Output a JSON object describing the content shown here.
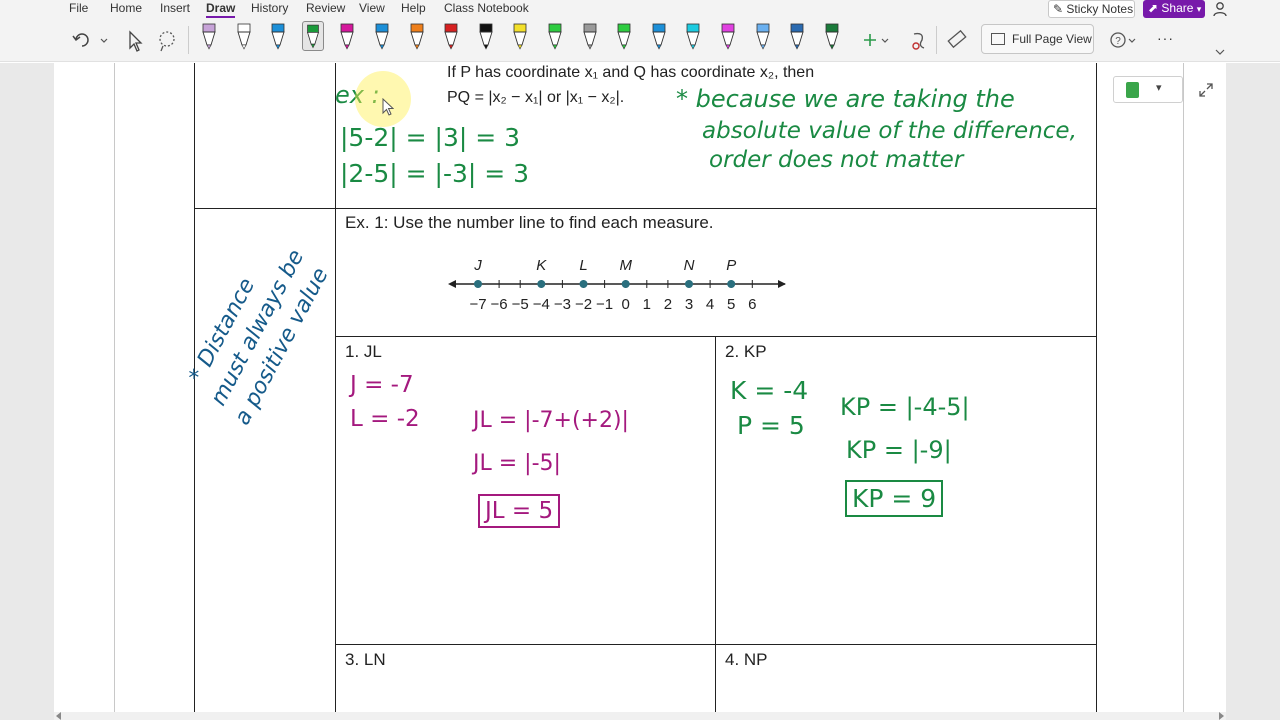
{
  "menu": {
    "items": [
      "File",
      "Home",
      "Insert",
      "Draw",
      "History",
      "Review",
      "View",
      "Help",
      "Class Notebook"
    ],
    "active": "Draw",
    "sticky_notes": "Sticky Notes",
    "share": "Share"
  },
  "ribbon": {
    "full_page_view": "Full Page View",
    "more": "···"
  },
  "pen_colors": [
    "#c7a3d8",
    "#ffffff",
    "#1c8fd8",
    "#1a9a3a",
    "#d4189c",
    "#1c8fd8",
    "#ee7f1b",
    "#d62020",
    "#111111",
    "#f3e02a",
    "#2ecc40",
    "#9a9a9a",
    "#2ecc40",
    "#1c8fd8",
    "#1ccbe0",
    "#e040e0",
    "#6ab0f0",
    "#2a6ab0",
    "#1a7a3a"
  ],
  "note": {
    "definition_line1": "If P has coordinate x₁ and Q has coordinate x₂, then",
    "definition_line2": "PQ = |x₂ − x₁| or |x₁ − x₂|.",
    "example1_label": "Ex. 1:  Use the number line to find each measure.",
    "number_line": {
      "points": [
        "J",
        "K",
        "L",
        "M",
        "N",
        "P"
      ],
      "ticks": [
        "−7",
        "−6",
        "−5",
        "−4",
        "−3",
        "−2",
        "−1",
        "0",
        "1",
        "2",
        "3",
        "4",
        "5",
        "6"
      ]
    },
    "problems": [
      "1.  JL",
      "2.  KP",
      "3.  LN",
      "4.  NP"
    ]
  },
  "ink": {
    "ex_label": "ex :",
    "ex_line1": "|5-2| = |3| = 3",
    "ex_line2": "|2-5| = |-3| = 3",
    "because_line1": "* because we are taking the",
    "because_line2": "absolute value of the difference,",
    "because_line3": "order does not matter",
    "margin_line1": "* Distance",
    "margin_line2": "must always be",
    "margin_line3": "a positive value",
    "jl_j": "J = -7",
    "jl_l": "L = -2",
    "jl_step1": "JL = |-7+(+2)|",
    "jl_step2": "JL = |-5|",
    "jl_answer": "JL = 5",
    "kp_k": "K = -4",
    "kp_p": "P = 5",
    "kp_step1": "KP = |-4-5|",
    "kp_step2": "KP = |-9|",
    "kp_answer": "KP = 9"
  }
}
